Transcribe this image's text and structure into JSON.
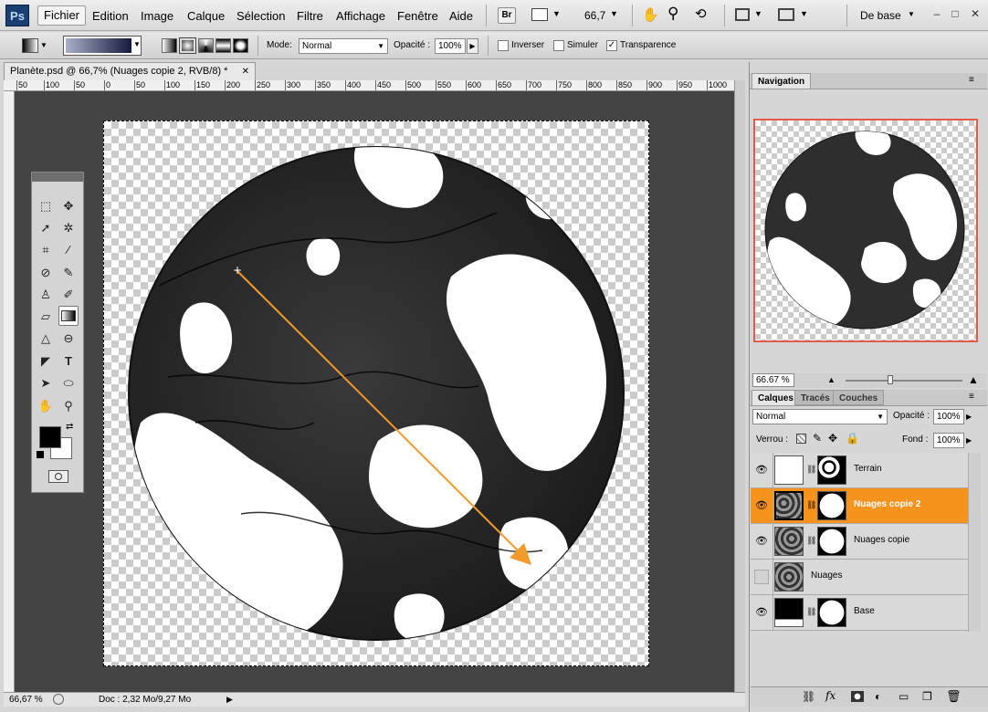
{
  "app": {
    "logo": "Ps"
  },
  "menu": [
    "Fichier",
    "Edition",
    "Image",
    "Calque",
    "Sélection",
    "Filtre",
    "Affichage",
    "Fenêtre",
    "Aide"
  ],
  "menubar": {
    "bridge": "Br",
    "zoom": "66,7",
    "workspace": "De base"
  },
  "options": {
    "mode_label": "Mode:",
    "mode_value": "Normal",
    "opacity_label": "Opacité :",
    "opacity_value": "100%",
    "invert_label": "Inverser",
    "dither_label": "Simuler",
    "transparency_label": "Transparence",
    "transparency_checked": true
  },
  "document": {
    "tab_title": "Planète.psd @ 66,7% (Nuages copie 2, RVB/8) *",
    "ruler_h": [
      "50",
      "100",
      "50",
      "0",
      "50",
      "100",
      "150",
      "200",
      "250",
      "300",
      "350",
      "400",
      "450",
      "500",
      "550",
      "600",
      "650",
      "700",
      "750",
      "800",
      "850",
      "900",
      "950",
      "1000"
    ],
    "zoom_status": "66,67 %",
    "doc_size": "Doc : 2,32 Mo/9,27 Mo"
  },
  "navigator": {
    "tab": "Navigation",
    "zoom": "66.67 %"
  },
  "layers_panel": {
    "tabs": [
      "Calques",
      "Tracés",
      "Couches"
    ],
    "blend_mode": "Normal",
    "opacity_label": "Opacité :",
    "opacity_value": "100%",
    "lock_label": "Verrou :",
    "fill_label": "Fond :",
    "fill_value": "100%",
    "layers": [
      {
        "name": "Terrain",
        "visible": true,
        "selected": false
      },
      {
        "name": "Nuages copie 2",
        "visible": true,
        "selected": true
      },
      {
        "name": "Nuages copie",
        "visible": true,
        "selected": false
      },
      {
        "name": "Nuages",
        "visible": false,
        "selected": false
      },
      {
        "name": "Base",
        "visible": true,
        "selected": false
      }
    ]
  },
  "colors": {
    "accent": "#f6921e",
    "nav_frame": "#e25a4a",
    "gradient_arrow": "#f39a2c"
  }
}
